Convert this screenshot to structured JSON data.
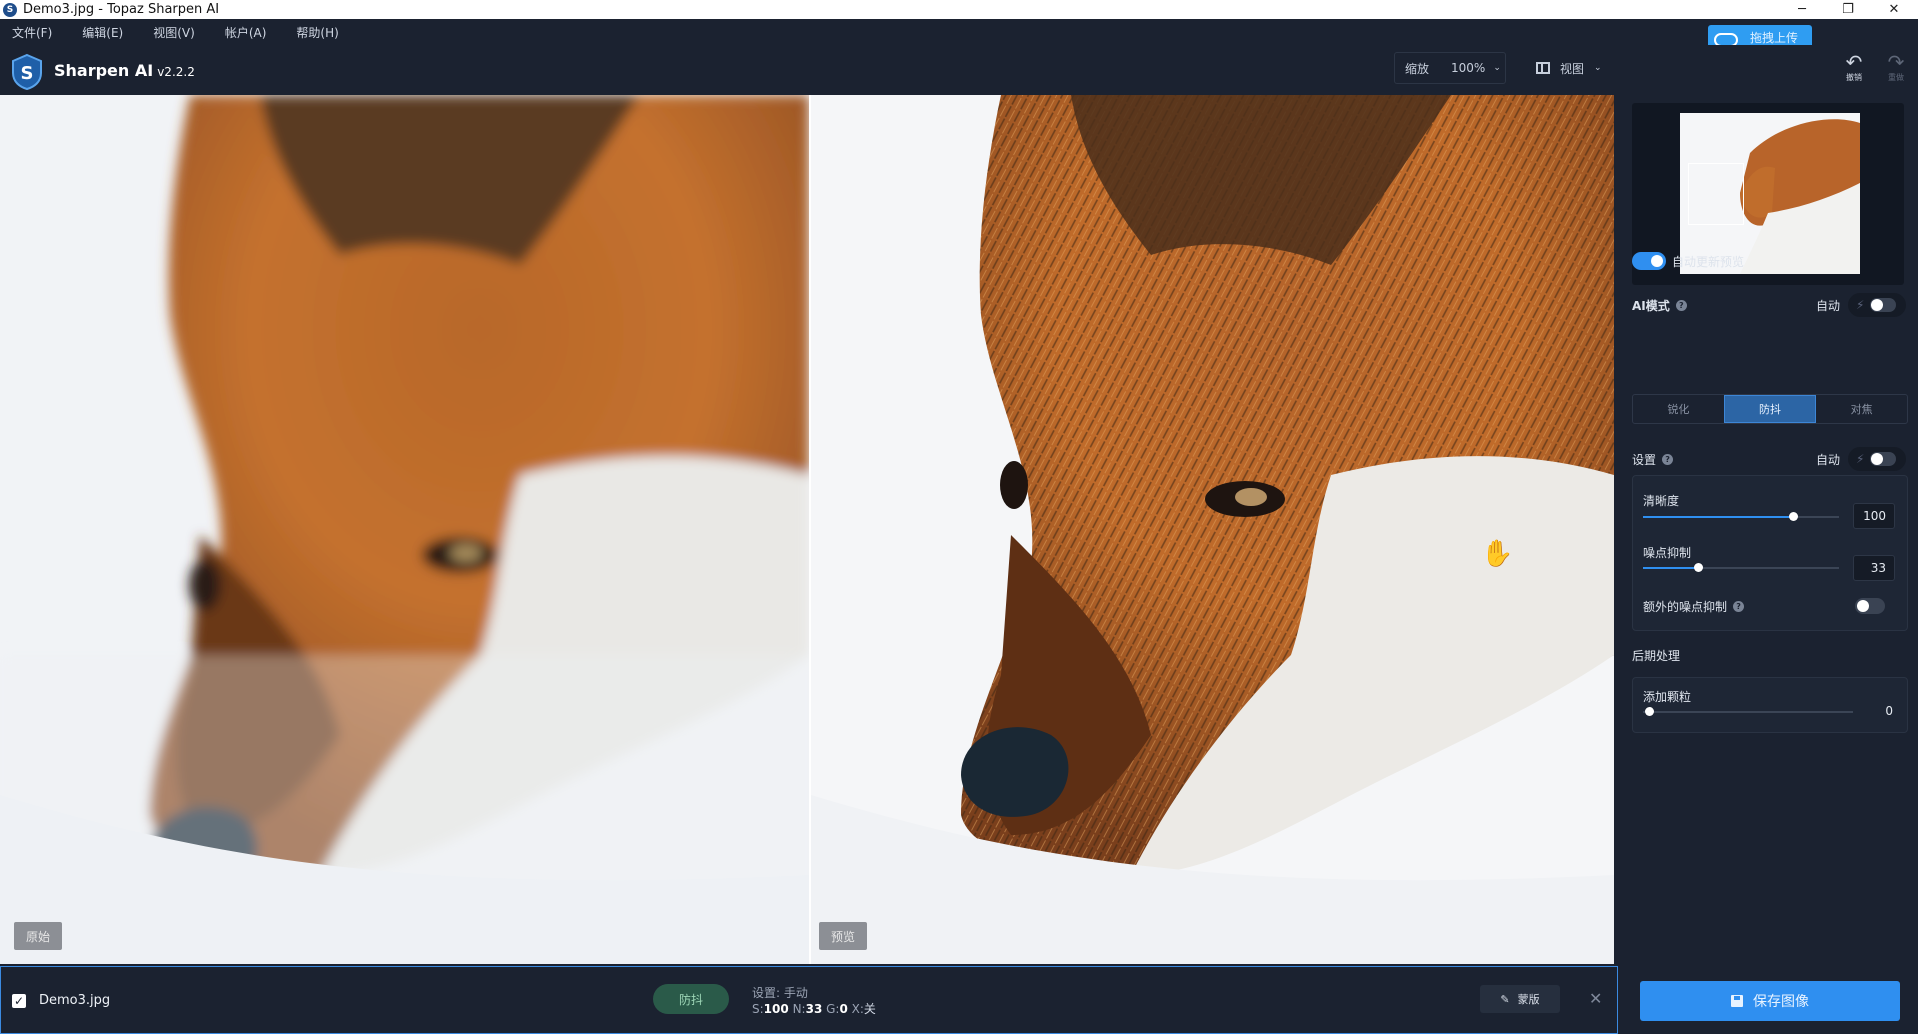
{
  "window": {
    "title": "Demo3.jpg - Topaz Sharpen AI",
    "app_icon": "S",
    "controls": [
      "─",
      "❐",
      "✕"
    ]
  },
  "menu": [
    "文件(F)",
    "编辑(E)",
    "视图(V)",
    "帐户(A)",
    "帮助(H)"
  ],
  "upload_button": "拖拽上传",
  "app": {
    "name": "Sharpen AI",
    "version": "v2.2.2"
  },
  "zoom": {
    "label": "缩放",
    "value": "100%"
  },
  "view": {
    "label": "视图"
  },
  "history": {
    "undo": "撤销",
    "redo": "重做"
  },
  "images": {
    "left_tag": "原始",
    "right_tag": "预览"
  },
  "sidebar": {
    "auto_preview": {
      "label": "自动更新预览",
      "on": true
    },
    "ai_mode": {
      "label": "AI模式",
      "auto_label": "自动",
      "tabs": [
        "锐化",
        "防抖",
        "对焦"
      ],
      "active_tab": "防抖"
    },
    "settings": {
      "label": "设置",
      "auto_label": "自动",
      "sharpness": {
        "label": "清晰度",
        "value": "100",
        "fraction": 1.0
      },
      "noise": {
        "label": "噪点抑制",
        "value": "33",
        "fraction": 0.33
      },
      "extra_noise": {
        "label": "额外的噪点抑制",
        "on": false
      }
    },
    "post": {
      "label": "后期处理",
      "grain": {
        "label": "添加颗粒",
        "value": "0",
        "fraction": 0.0
      }
    }
  },
  "filebar": {
    "checked": true,
    "filename": "Demo3.jpg",
    "mode": "防抖",
    "settings_line": "设置: 手动",
    "s_label": "S:",
    "s_value": "100",
    "n_label": "N:",
    "n_value": "33",
    "g_label": "G:",
    "g_value": "0",
    "x_label": "X:",
    "x_value": "关",
    "mask_label": "蒙版"
  },
  "save_label": "保存图像",
  "colors": {
    "accent": "#2f8ff0",
    "background": "#1b2230",
    "mode_pill": "#2a5a49"
  }
}
